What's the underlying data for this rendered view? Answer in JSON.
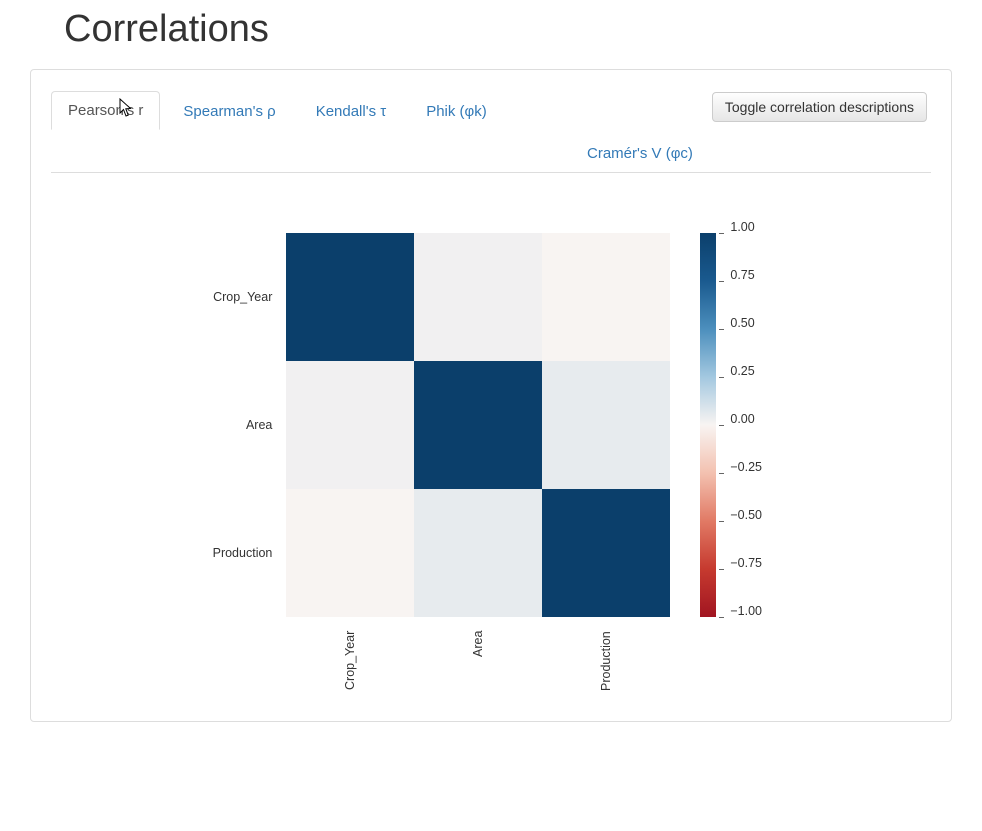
{
  "title": "Correlations",
  "tabs": [
    {
      "key": "pearson",
      "label": "Pearson's r",
      "active": true
    },
    {
      "key": "spearman",
      "label": "Spearman's ρ",
      "active": false
    },
    {
      "key": "kendall",
      "label": "Kendall's τ",
      "active": false
    },
    {
      "key": "phik",
      "label": "Phik (φk)",
      "active": false
    }
  ],
  "tab_extra": {
    "key": "cramer",
    "label": "Cramér's V (φc)"
  },
  "toggle_button": "Toggle correlation descriptions",
  "chart_data": {
    "type": "heatmap",
    "variables": [
      "Crop_Year",
      "Area",
      "Production"
    ],
    "matrix": [
      [
        1.0,
        0.02,
        0.0
      ],
      [
        0.02,
        1.0,
        0.05
      ],
      [
        0.0,
        0.05,
        1.0
      ]
    ],
    "colorbar": {
      "min": -1.0,
      "max": 1.0,
      "ticks": [
        1.0,
        0.75,
        0.5,
        0.25,
        0.0,
        -0.25,
        -0.5,
        -0.75,
        -1.0
      ],
      "tick_labels": [
        "1.00",
        "0.75",
        "0.50",
        "0.25",
        "0.00",
        "−0.25",
        "−0.50",
        "−0.75",
        "−1.00"
      ]
    }
  }
}
